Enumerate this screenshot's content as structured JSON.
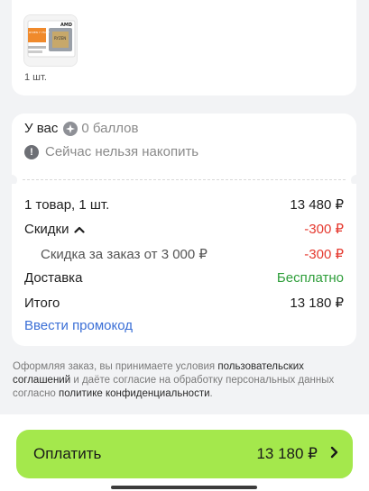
{
  "product": {
    "image_icon": "cpu-box-icon",
    "box_label": "AMD",
    "chip_label": "RYZEN",
    "chip_model": "RYZEN 7 7500F",
    "quantity": "1 шт."
  },
  "points": {
    "prefix": "У вас",
    "icon": "points-coin-icon",
    "value": "0 баллов",
    "info_icon": "info-icon",
    "info_text": "Сейчас нельзя накопить"
  },
  "summary": {
    "items_label": "1 товар, 1 шт.",
    "items_value": "13 480 ₽",
    "discounts_label": "Скидки",
    "discounts_value": "-300 ₽",
    "order_discount_label": "Скидка за заказ от 3 000 ₽",
    "order_discount_value": "-300 ₽",
    "delivery_label": "Доставка",
    "delivery_value": "Бесплатно",
    "total_label": "Итого",
    "total_value": "13 180 ₽",
    "promo_link": "Ввести промокод"
  },
  "legal": {
    "part1": "Оформляя заказ, вы принимаете условия ",
    "link1": "пользовательских соглашений",
    "part2": " и даёте согласие на обработку персональных данных согласно ",
    "link2": "политике конфиденциальности",
    "part3": "."
  },
  "pay_button": {
    "label": "Оплатить",
    "total": "13 180 ₽"
  },
  "colors": {
    "accent_green": "#a4e84c",
    "discount_red": "#e5392f",
    "free_green": "#2e9e3a",
    "link_blue": "#3b6fd6"
  }
}
